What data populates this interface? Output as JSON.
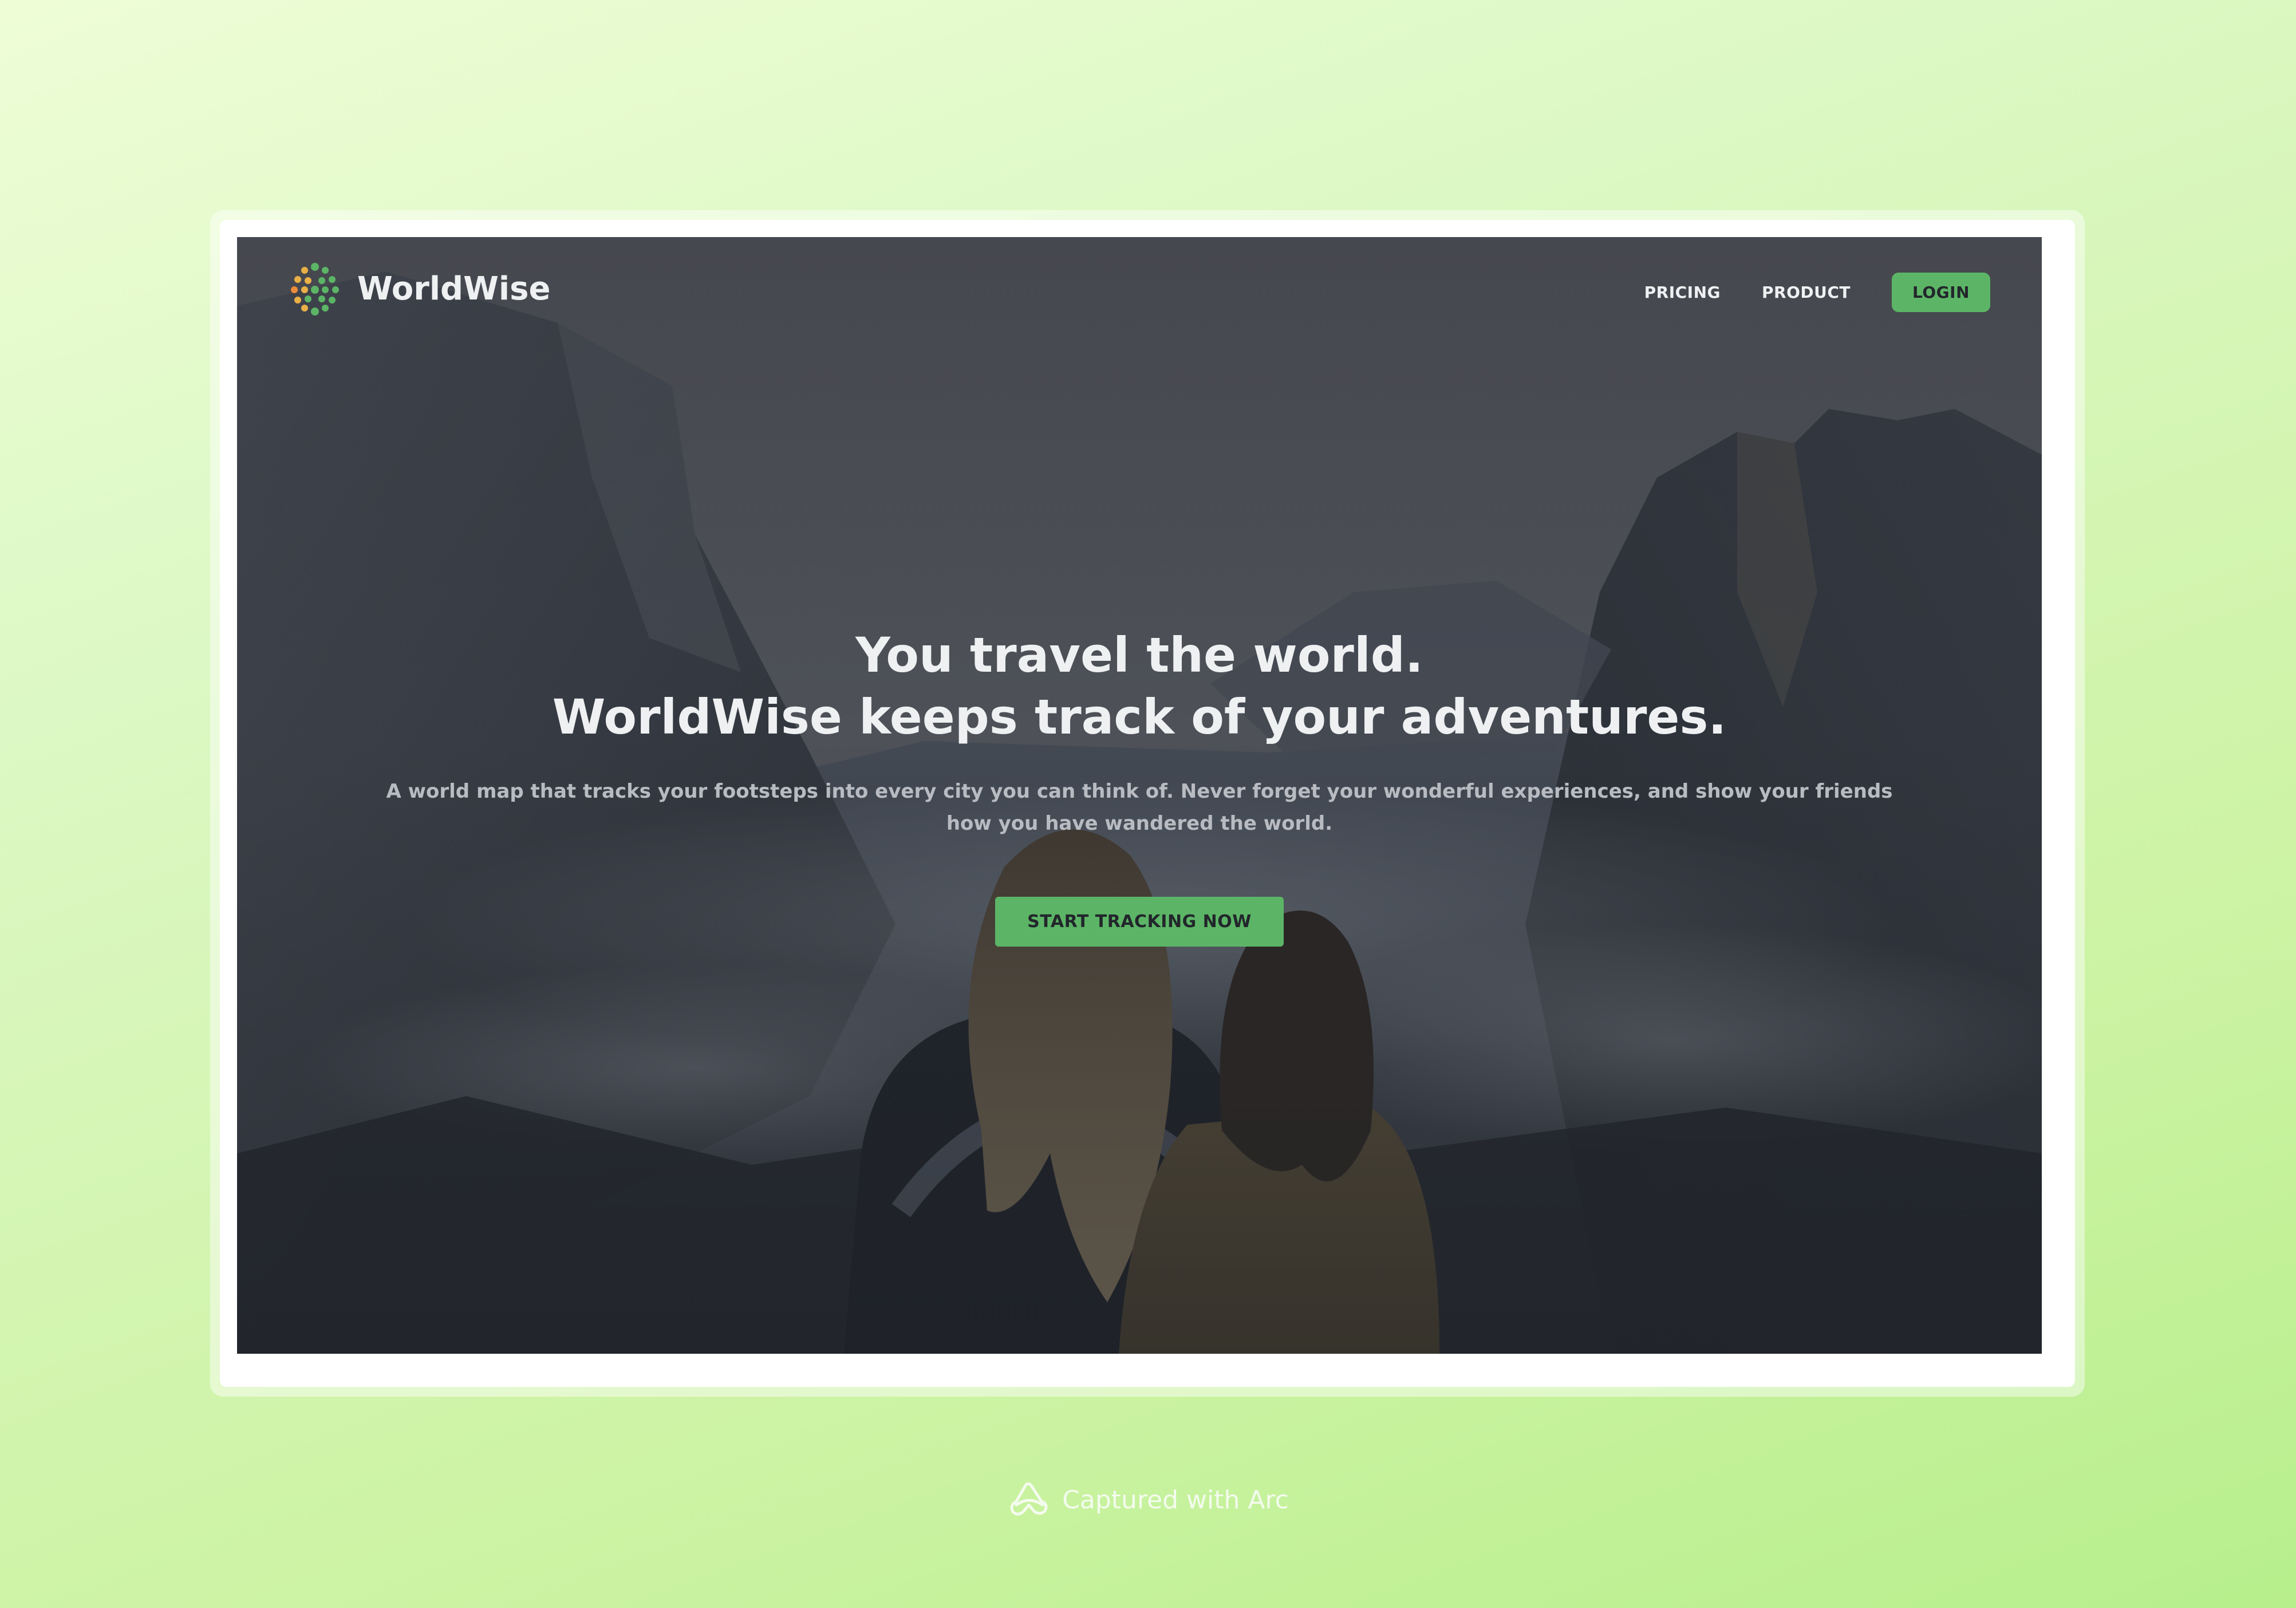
{
  "app": {
    "brand_name": "WorldWise",
    "logo_icon": "worldwise-globe-icon"
  },
  "nav": {
    "items": [
      {
        "label": "PRICING"
      },
      {
        "label": "PRODUCT"
      }
    ],
    "login_label": "LOGIN"
  },
  "hero": {
    "headline_line1": "You travel the world.",
    "headline_line2": "WorldWise keeps track of your adventures.",
    "subtext": "A world map that tracks your footsteps into every city you can think of. Never forget your wonderful experiences, and show your friends how you have wandered the world.",
    "cta_label": "START TRACKING NOW"
  },
  "footer": {
    "caption": "Captured with Arc",
    "icon": "arc-browser-icon"
  },
  "colors": {
    "accent": "#5cb566",
    "background_gradient_start": "#eefdd6",
    "background_gradient_end": "#b7ef8c",
    "hero_text": "#eef0f2"
  }
}
